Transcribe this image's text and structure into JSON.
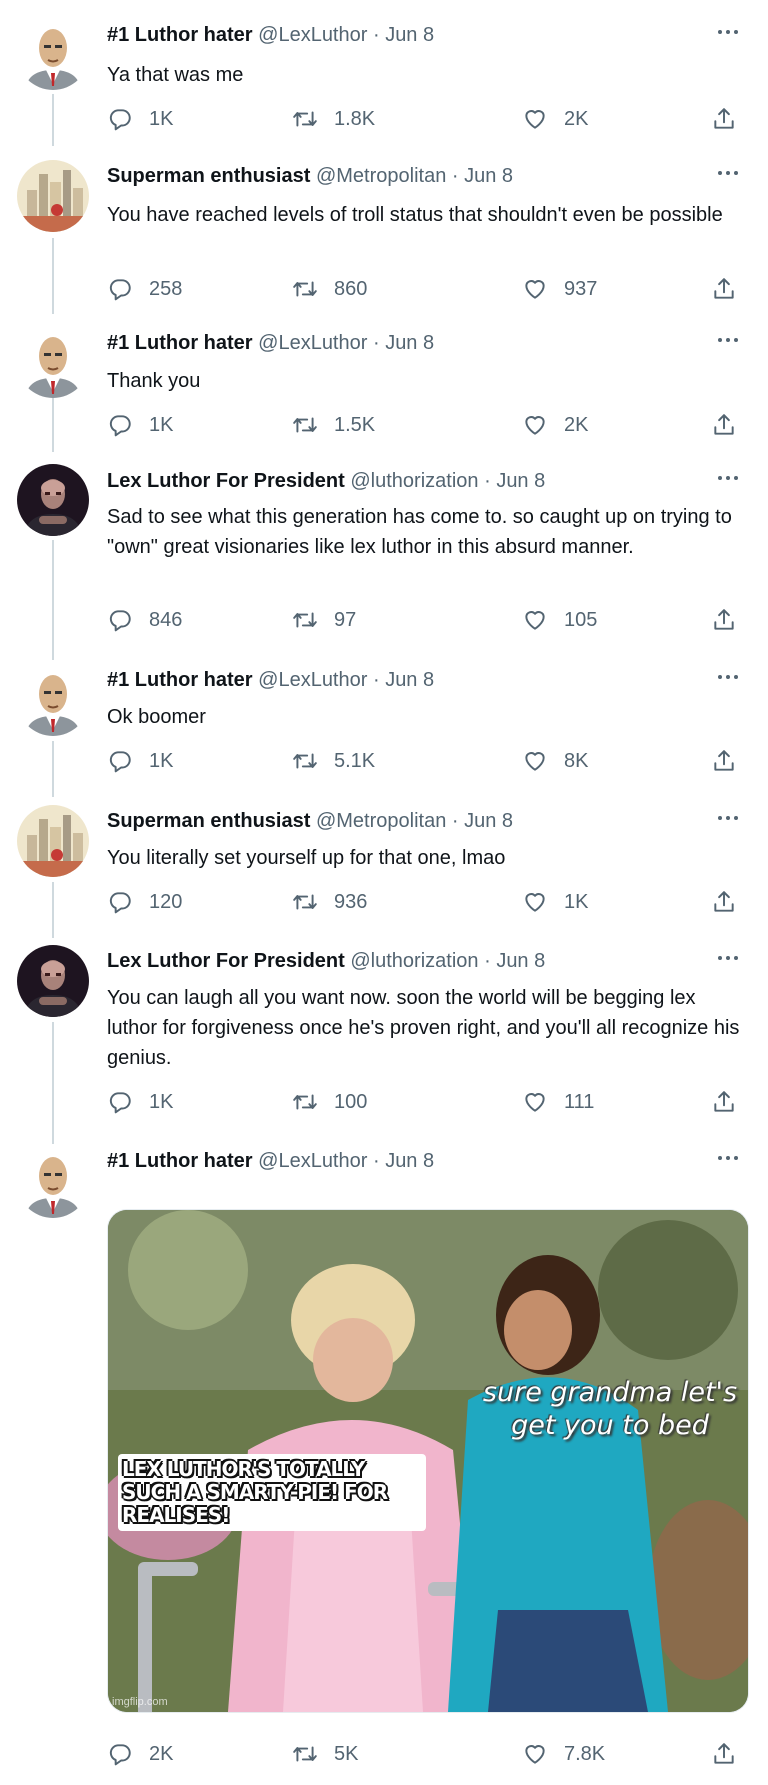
{
  "tweets": [
    {
      "name": "#1 Luthor hater",
      "handle": "@LexLuthor",
      "date": "Jun 8",
      "text": "Ya that was me",
      "replies": "1K",
      "retweets": "1.8K",
      "likes": "2K",
      "avatar": "lex-luthor"
    },
    {
      "name": "Superman enthusiast",
      "handle": "@Metropolitan",
      "date": "Jun 8",
      "text": "You have reached levels of troll status that shouldn't even be possible",
      "replies": "258",
      "retweets": "860",
      "likes": "937",
      "avatar": "city-skyline"
    },
    {
      "name": "#1 Luthor hater",
      "handle": "@LexLuthor",
      "date": "Jun 8",
      "text": "Thank you",
      "replies": "1K",
      "retweets": "1.5K",
      "likes": "2K",
      "avatar": "lex-luthor"
    },
    {
      "name": "Lex Luthor For President",
      "handle": "@luthorization",
      "date": "Jun 8",
      "text": "Sad to see what this generation has come to. so caught up on trying to \"own\" great visionaries like lex luthor in this absurd manner.",
      "replies": "846",
      "retweets": "97",
      "likes": "105",
      "avatar": "dark-figure"
    },
    {
      "name": "#1 Luthor hater",
      "handle": "@LexLuthor",
      "date": "Jun 8",
      "text": "Ok boomer",
      "replies": "1K",
      "retweets": "5.1K",
      "likes": "8K",
      "avatar": "lex-luthor"
    },
    {
      "name": "Superman enthusiast",
      "handle": "@Metropolitan",
      "date": "Jun 8",
      "text": "You literally set yourself up for that one, lmao",
      "replies": "120",
      "retweets": "936",
      "likes": "1K",
      "avatar": "city-skyline"
    },
    {
      "name": "Lex Luthor For President",
      "handle": "@luthorization",
      "date": "Jun 8",
      "text": "You can laugh all you want now. soon the world will be begging lex luthor for forgiveness once he's proven right, and you'll all recognize his genius.",
      "replies": "1K",
      "retweets": "100",
      "likes": "111",
      "avatar": "dark-figure"
    },
    {
      "name": "#1 Luthor hater",
      "handle": "@LexLuthor",
      "date": "Jun 8",
      "text": "",
      "replies": "2K",
      "retweets": "5K",
      "likes": "7.8K",
      "avatar": "lex-luthor"
    }
  ],
  "meme": {
    "caption_right": "sure grandma let's get you to bed",
    "caption_left": "LEX LUTHOR'S TOTALLY SUCH A SMARTY-PIE! FOR REALISES!",
    "watermark": "imgflip.com"
  },
  "separator": " · ",
  "colors": {
    "text": "#0f1419",
    "meta": "#536471",
    "thread": "#cfd9de"
  },
  "icons": {
    "reply": "reply-icon",
    "retweet": "retweet-icon",
    "like": "heart-icon",
    "share": "share-icon",
    "more": "more-icon"
  }
}
